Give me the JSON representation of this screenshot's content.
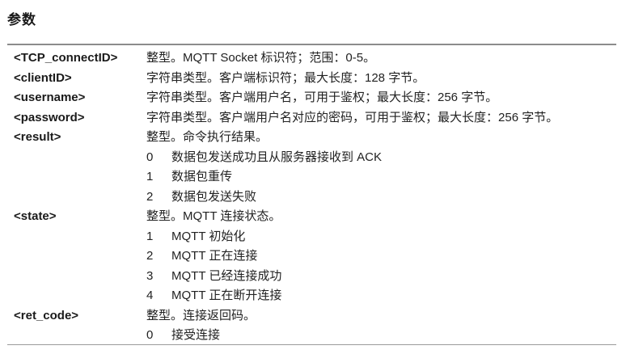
{
  "section_title": "参数",
  "params": [
    {
      "name": "<TCP_connectID>",
      "description": "整型。MQTT Socket 标识符；范围：0-5。",
      "values": []
    },
    {
      "name": "<clientID>",
      "description": "字符串类型。客户端标识符；最大长度：128 字节。",
      "values": []
    },
    {
      "name": "<username>",
      "description": "字符串类型。客户端用户名，可用于鉴权；最大长度：256 字节。",
      "values": []
    },
    {
      "name": "<password>",
      "description": "字符串类型。客户端用户名对应的密码，可用于鉴权；最大长度：256 字节。",
      "values": []
    },
    {
      "name": "<result>",
      "description": "整型。命令执行结果。",
      "values": [
        {
          "code": "0",
          "text": "数据包发送成功且从服务器接收到 ACK"
        },
        {
          "code": "1",
          "text": "数据包重传"
        },
        {
          "code": "2",
          "text": "数据包发送失败"
        }
      ]
    },
    {
      "name": "<state>",
      "description": "整型。MQTT 连接状态。",
      "values": [
        {
          "code": "1",
          "text": "MQTT 初始化"
        },
        {
          "code": "2",
          "text": "MQTT 正在连接"
        },
        {
          "code": "3",
          "text": "MQTT 已经连接成功"
        },
        {
          "code": "4",
          "text": "MQTT 正在断开连接"
        }
      ]
    },
    {
      "name": "<ret_code>",
      "description": "整型。连接返回码。",
      "values": [
        {
          "code": "0",
          "text": "接受连接"
        }
      ]
    }
  ]
}
